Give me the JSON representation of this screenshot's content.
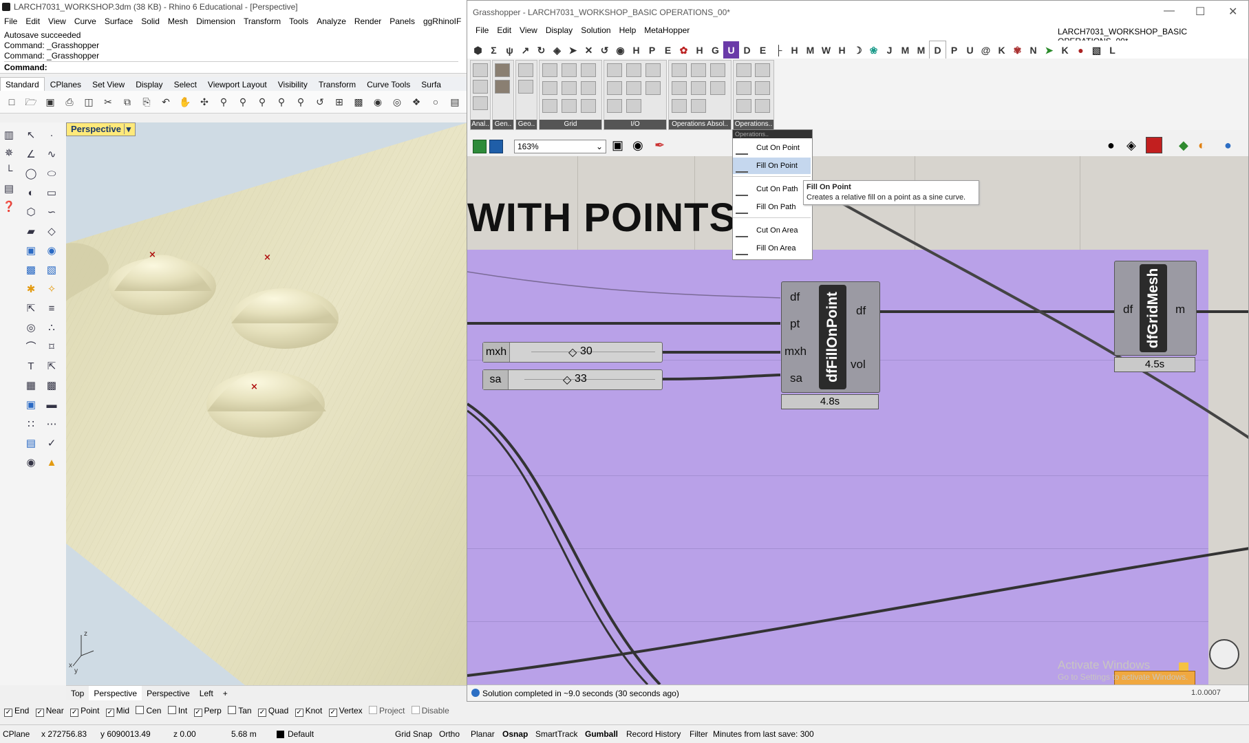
{
  "rhino": {
    "title": "LARCH7031_WORKSHOP.3dm (38 KB) - Rhino 6 Educational - [Perspective]",
    "menu": [
      "File",
      "Edit",
      "View",
      "Curve",
      "Surface",
      "Solid",
      "Mesh",
      "Dimension",
      "Transform",
      "Tools",
      "Analyze",
      "Render",
      "Panels",
      "ggRhinoIF"
    ],
    "command_history": [
      "Autosave succeeded",
      "Command: _Grasshopper",
      "Command: _Grasshopper"
    ],
    "command_prompt": "Command:",
    "toolbar_tabs": [
      "Standard",
      "CPlanes",
      "Set View",
      "Display",
      "Select",
      "Viewport Layout",
      "Visibility",
      "Transform",
      "Curve Tools",
      "Surfa"
    ],
    "active_tab": "Standard",
    "viewport_label": "Perspective",
    "viewport_tabs": [
      "Top",
      "Perspective",
      "Perspective",
      "Left"
    ],
    "add_tab_symbol": "+",
    "osnaps": [
      {
        "label": "End",
        "checked": true
      },
      {
        "label": "Near",
        "checked": true
      },
      {
        "label": "Point",
        "checked": true
      },
      {
        "label": "Mid",
        "checked": true
      },
      {
        "label": "Cen",
        "checked": false
      },
      {
        "label": "Int",
        "checked": false
      },
      {
        "label": "Perp",
        "checked": true
      },
      {
        "label": "Tan",
        "checked": false
      },
      {
        "label": "Quad",
        "checked": true
      },
      {
        "label": "Knot",
        "checked": true
      },
      {
        "label": "Vertex",
        "checked": true
      },
      {
        "label": "Project",
        "checked": false
      },
      {
        "label": "Disable",
        "checked": false
      }
    ],
    "status": {
      "cplane": "CPlane",
      "x": "x 272756.83",
      "y": "y 6090013.49",
      "z": "z 0.00",
      "unit": "5.68 m",
      "layer": "Default",
      "toggles": [
        "Grid Snap",
        "Ortho",
        "Planar",
        "Osnap",
        "SmartTrack",
        "Gumball",
        "Record History",
        "Filter"
      ],
      "bold_toggles": [
        "Osnap",
        "Gumball"
      ],
      "save_info": "Minutes from last save: 300"
    },
    "axis_labels": {
      "x": "x",
      "y": "y",
      "z": "z"
    }
  },
  "grasshopper": {
    "title": "Grasshopper - LARCH7031_WORKSHOP_BASIC OPERATIONS_00*",
    "file_name": "LARCH7031_WORKSHOP_BASIC OPERATIONS_00*",
    "menu": [
      "File",
      "Edit",
      "View",
      "Display",
      "Solution",
      "Help",
      "MetaHopper"
    ],
    "tabs": [
      "H",
      "P",
      "E",
      "D",
      "E",
      "H",
      "M",
      "W",
      "H",
      "J",
      "M",
      "D",
      "P",
      "U",
      "K",
      "N",
      "K",
      "L"
    ],
    "active_tab": "D",
    "ribbon_panels": [
      "Anal..",
      "Gen..",
      "Geo..",
      "Grid",
      "I/O",
      "Operations Absol..",
      "Operations.."
    ],
    "zoom": "163%",
    "canvas_heading": "WITH POINTS",
    "components": {
      "fill": {
        "name": "dfFillOnPoint",
        "inputs": [
          "df",
          "pt",
          "mxh",
          "sa"
        ],
        "outputs": [
          "df",
          "vol"
        ],
        "time": "4.8s"
      },
      "grid": {
        "name": "dfGridMesh",
        "inputs": [
          "df"
        ],
        "outputs": [
          "m"
        ],
        "time": "4.5s"
      }
    },
    "sliders": [
      {
        "label": "mxh",
        "value": "30"
      },
      {
        "label": "sa",
        "value": "33"
      }
    ],
    "dropdown": {
      "header": "Operations..",
      "items": [
        "Cut On Point",
        "Fill On Point",
        "Cut On Path",
        "Fill On Path",
        "Cut On Area",
        "Fill On Area"
      ],
      "highlighted": "Fill On Point"
    },
    "tooltip": {
      "title": "Fill On Point",
      "description": "Creates a relative fill on a point as a sine curve."
    },
    "status_text": "Solution completed in ~9.0 seconds (30 seconds ago)",
    "version": "1.0.0007",
    "watermark_1": "Activate Windows",
    "watermark_2": "Go to Settings to activate Windows."
  },
  "colors": {
    "group": "#b9a1e8",
    "canvas": "#d7d4ce",
    "terrain": "#e6e2bf",
    "sky": "#cfdbe4",
    "point_marker": "#b01010"
  }
}
